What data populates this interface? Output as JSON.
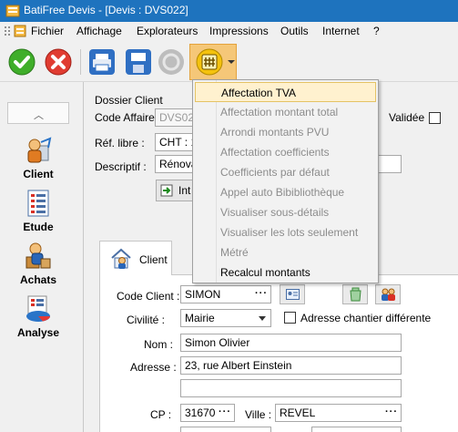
{
  "window": {
    "title": "BatiFree Devis - [Devis : DVS022]"
  },
  "menubar": {
    "items": [
      "Fichier",
      "Affichage",
      "Explorateurs",
      "Impressions",
      "Outils",
      "Internet",
      "?"
    ]
  },
  "toolbar": {
    "buttons": [
      "check-icon",
      "cancel-icon",
      "print-icon",
      "save-icon",
      "disabled-icon",
      "calculator-icon"
    ]
  },
  "sidebar": {
    "items": [
      {
        "label": "Client",
        "icon": "client-icon"
      },
      {
        "label": "Etude",
        "icon": "etude-icon"
      },
      {
        "label": "Achats",
        "icon": "achats-icon"
      },
      {
        "label": "Analyse",
        "icon": "analyse-icon"
      }
    ]
  },
  "dossier": {
    "section_label": "Dossier Client",
    "code_affaire_label": "Code Affaire :",
    "code_affaire_value": "DVS022",
    "validee_label": "Validée",
    "ref_libre_label": "Réf. libre :",
    "ref_libre_value": "CHT : 1",
    "descriptif_label": "Descriptif :",
    "descriptif_value": "Rénova",
    "int_button": "Int"
  },
  "dropdown": {
    "items": [
      {
        "label": "Affectation TVA",
        "state": "highlighted"
      },
      {
        "label": "Affectation montant total",
        "state": "disabled"
      },
      {
        "label": "Arrondi montants PVU",
        "state": "disabled"
      },
      {
        "label": "Affectation coefficients",
        "state": "disabled"
      },
      {
        "label": "Coefficients par défaut",
        "state": "disabled"
      },
      {
        "label": "Appel auto Bibibliothèque",
        "state": "disabled"
      },
      {
        "label": "Visualiser sous-détails",
        "state": "disabled"
      },
      {
        "label": "Visualiser les lots seulement",
        "state": "disabled"
      },
      {
        "label": "Métré",
        "state": "disabled"
      },
      {
        "label": "Recalcul montants",
        "state": "enabled"
      }
    ]
  },
  "client_tab": {
    "tab_label": "Client",
    "code_client_label": "Code Client :",
    "code_client_value": "SIMON",
    "civilite_label": "Civilité :",
    "civilite_value": "Mairie",
    "adresse_chantier_label": "Adresse chantier différente",
    "nom_label": "Nom :",
    "nom_value": "Simon Olivier",
    "adresse_label": "Adresse :",
    "adresse_value": "23, rue Albert Einstein",
    "adresse2_value": "",
    "cp_label": "CP :",
    "cp_value": "31670",
    "ville_label": "Ville :",
    "ville_value": "REVEL"
  },
  "colors": {
    "title_bar": "#1e73be",
    "highlight": "#fff1cf",
    "highlight_border": "#e5c365",
    "active_tool": "#f5c778"
  }
}
